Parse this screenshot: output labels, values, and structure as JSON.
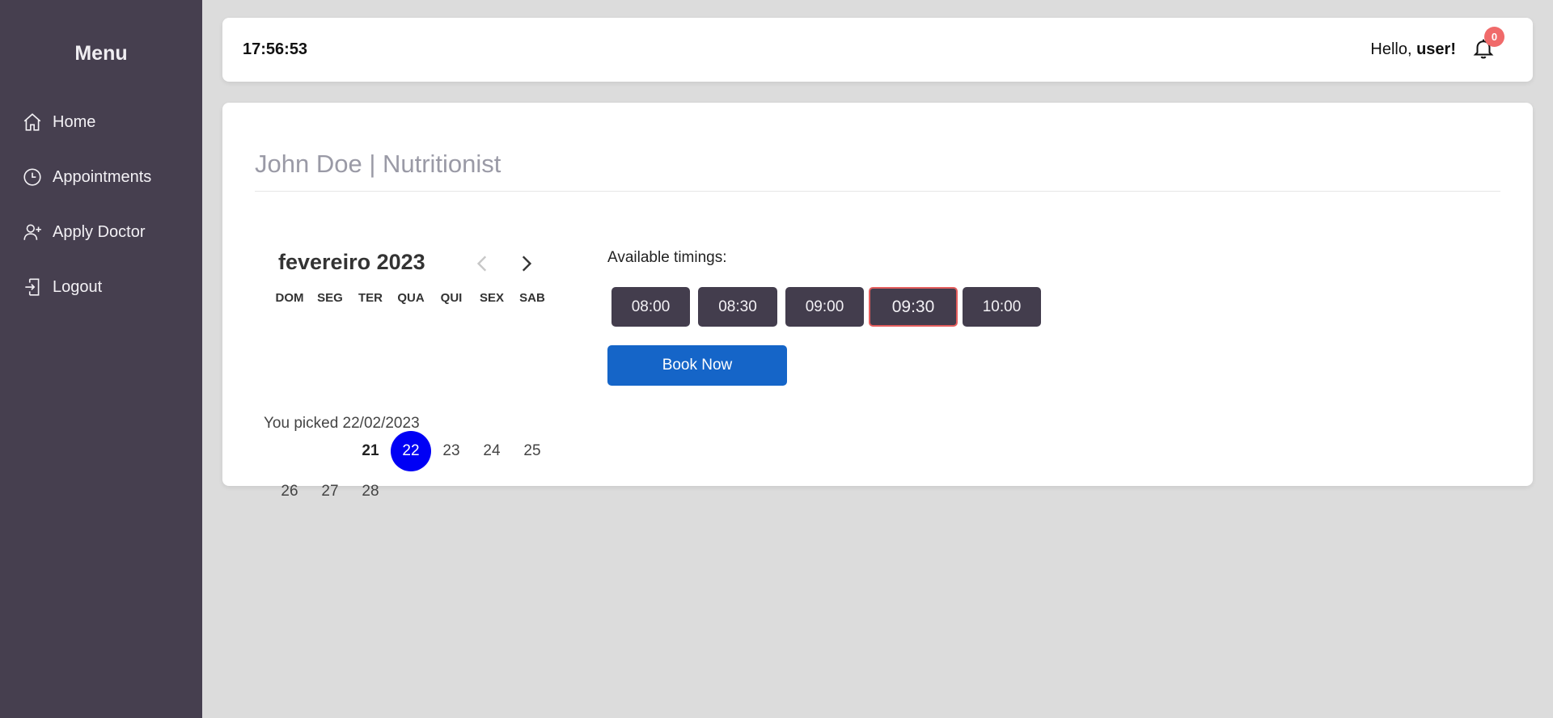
{
  "sidebar": {
    "title": "Menu",
    "items": [
      {
        "label": "Home",
        "icon": "home-icon"
      },
      {
        "label": "Appointments",
        "icon": "clock-icon"
      },
      {
        "label": "Apply Doctor",
        "icon": "user-plus-icon"
      },
      {
        "label": "Logout",
        "icon": "logout-icon"
      }
    ]
  },
  "header": {
    "clock": "17:56:53",
    "greeting_prefix": "Hello, ",
    "username": "user!",
    "notification_count": "0"
  },
  "doctor": {
    "heading": "John Doe | Nutritionist"
  },
  "calendar": {
    "month_label": "fevereiro 2023",
    "weekdays": [
      "DOM",
      "SEG",
      "TER",
      "QUA",
      "QUI",
      "SEX",
      "SAB"
    ],
    "days": [
      "21",
      "22",
      "23",
      "24",
      "25",
      "26",
      "27",
      "28"
    ],
    "today": "21",
    "selected": "22",
    "picked_text": "You picked 22/02/2023"
  },
  "timings": {
    "label": "Available timings:",
    "slots": [
      "08:00",
      "08:30",
      "09:00",
      "09:30",
      "10:00"
    ],
    "selected_slot": "09:30"
  },
  "actions": {
    "book_label": "Book Now"
  },
  "colors": {
    "sidebar_bg": "#463f4f",
    "slot_bg": "#433d4d",
    "selected_day": "#0000f5",
    "book_button": "#1565c8",
    "badge": "#f06a6a",
    "slot_active_border": "#e35d5d"
  }
}
